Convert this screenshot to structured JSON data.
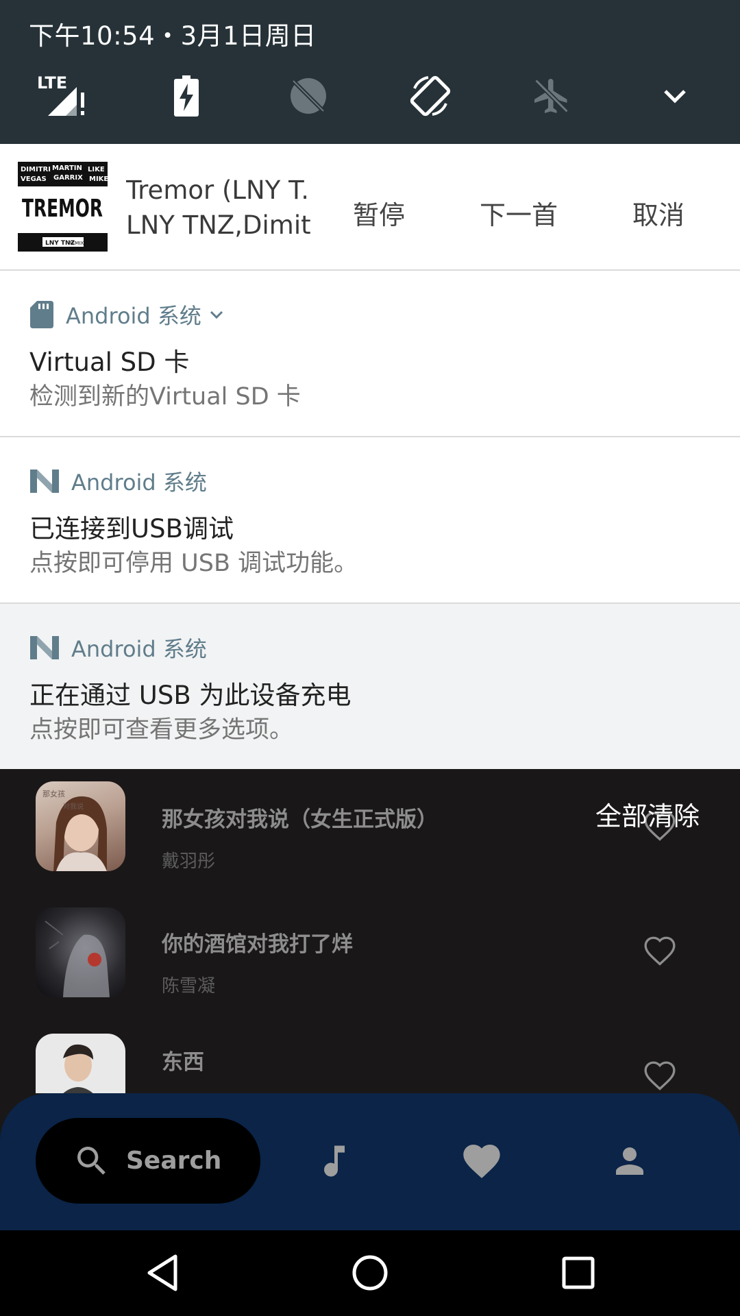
{
  "status": {
    "datetime": "下午10:54・3月1日周日",
    "lte_label": "LTE"
  },
  "quick_settings": [
    {
      "name": "lte-signal-icon"
    },
    {
      "name": "battery-charging-icon"
    },
    {
      "name": "data-saver-off-icon"
    },
    {
      "name": "auto-rotate-icon"
    },
    {
      "name": "airplane-mode-icon"
    },
    {
      "name": "expand-chevron-icon"
    }
  ],
  "media": {
    "art_lines": [
      "DIMITRI",
      "MARTIN",
      "LIKE",
      "VEGAS",
      "GARRIX",
      "MIKE",
      "TREMOR",
      "LNY TNZ",
      "REMIX"
    ],
    "title": "Tremor (LNY T...",
    "artist": "LNY TNZ,Dimit...",
    "actions": [
      "暂停",
      "下一首",
      "取消"
    ]
  },
  "notifications": [
    {
      "app": "Android 系统",
      "title": "Virtual SD 卡",
      "text": "检测到新的Virtual SD 卡",
      "icon": "sd-card-icon",
      "expandable": true
    },
    {
      "app": "Android 系统",
      "title": "已连接到USB调试",
      "text": "点按即可停用 USB 调试功能。",
      "icon": "android-n-icon",
      "expandable": false
    },
    {
      "app": "Android 系统",
      "title": "正在通过 USB 为此设备充电",
      "text": "点按即可查看更多选项。",
      "icon": "android-n-icon",
      "expandable": false
    }
  ],
  "clear_all": "全部清除",
  "songs": [
    {
      "title": "那女孩对我说（女生正式版）",
      "artist": "戴羽彤",
      "cover_lines": [
        "那女孩",
        "对我说"
      ]
    },
    {
      "title": "你的酒馆对我打了烊",
      "artist": "陈雪凝"
    },
    {
      "title": "东西",
      "artist": ""
    }
  ],
  "bottom_nav": {
    "search_label": "Search",
    "items": [
      "music-note-icon",
      "heart-icon",
      "person-icon"
    ]
  },
  "system_nav": [
    "back-icon",
    "home-icon",
    "recents-icon"
  ],
  "colors": {
    "qs_background": "#263238",
    "app_label": "#607d8b",
    "bottom_nav": "#0b2448",
    "app_background": "#1a1718"
  }
}
